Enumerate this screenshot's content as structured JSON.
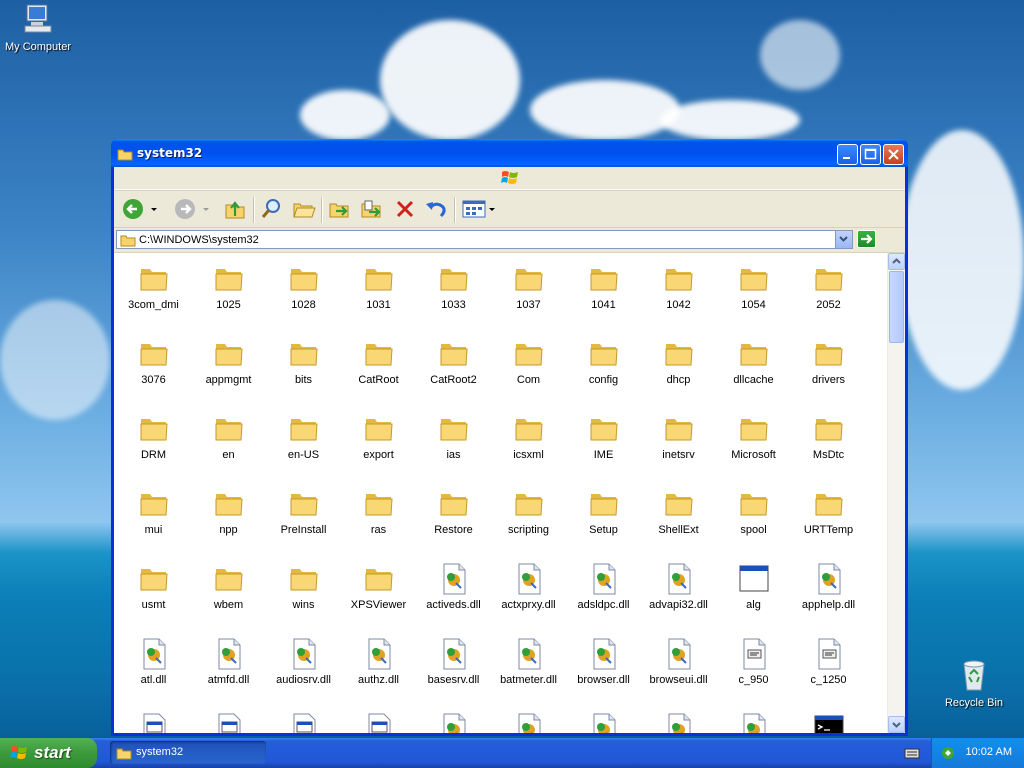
{
  "desktop": {
    "icons": [
      {
        "label": "My Computer"
      },
      {
        "label": "Recycle Bin"
      }
    ]
  },
  "window": {
    "title": "system32",
    "address": "C:\\WINDOWS\\system32"
  },
  "items": [
    {
      "label": "3com_dmi",
      "type": "folder"
    },
    {
      "label": "1025",
      "type": "folder"
    },
    {
      "label": "1028",
      "type": "folder"
    },
    {
      "label": "1031",
      "type": "folder"
    },
    {
      "label": "1033",
      "type": "folder"
    },
    {
      "label": "1037",
      "type": "folder"
    },
    {
      "label": "1041",
      "type": "folder"
    },
    {
      "label": "1042",
      "type": "folder"
    },
    {
      "label": "1054",
      "type": "folder"
    },
    {
      "label": "2052",
      "type": "folder"
    },
    {
      "label": "3076",
      "type": "folder"
    },
    {
      "label": "appmgmt",
      "type": "folder"
    },
    {
      "label": "bits",
      "type": "folder"
    },
    {
      "label": "CatRoot",
      "type": "folder"
    },
    {
      "label": "CatRoot2",
      "type": "folder"
    },
    {
      "label": "Com",
      "type": "folder"
    },
    {
      "label": "config",
      "type": "folder"
    },
    {
      "label": "dhcp",
      "type": "folder"
    },
    {
      "label": "dllcache",
      "type": "folder"
    },
    {
      "label": "drivers",
      "type": "folder"
    },
    {
      "label": "DRM",
      "type": "folder"
    },
    {
      "label": "en",
      "type": "folder"
    },
    {
      "label": "en-US",
      "type": "folder"
    },
    {
      "label": "export",
      "type": "folder"
    },
    {
      "label": "ias",
      "type": "folder"
    },
    {
      "label": "icsxml",
      "type": "folder"
    },
    {
      "label": "IME",
      "type": "folder"
    },
    {
      "label": "inetsrv",
      "type": "folder"
    },
    {
      "label": "Microsoft",
      "type": "folder"
    },
    {
      "label": "MsDtc",
      "type": "folder"
    },
    {
      "label": "mui",
      "type": "folder"
    },
    {
      "label": "npp",
      "type": "folder"
    },
    {
      "label": "PreInstall",
      "type": "folder"
    },
    {
      "label": "ras",
      "type": "folder"
    },
    {
      "label": "Restore",
      "type": "folder"
    },
    {
      "label": "scripting",
      "type": "folder"
    },
    {
      "label": "Setup",
      "type": "folder"
    },
    {
      "label": "ShellExt",
      "type": "folder"
    },
    {
      "label": "spool",
      "type": "folder"
    },
    {
      "label": "URTTemp",
      "type": "folder"
    },
    {
      "label": "usmt",
      "type": "folder"
    },
    {
      "label": "wbem",
      "type": "folder"
    },
    {
      "label": "wins",
      "type": "folder"
    },
    {
      "label": "XPSViewer",
      "type": "folder"
    },
    {
      "label": "activeds.dll",
      "type": "dll"
    },
    {
      "label": "actxprxy.dll",
      "type": "dll"
    },
    {
      "label": "adsldpc.dll",
      "type": "dll"
    },
    {
      "label": "advapi32.dll",
      "type": "dll"
    },
    {
      "label": "alg",
      "type": "exe"
    },
    {
      "label": "apphelp.dll",
      "type": "dll"
    },
    {
      "label": "atl.dll",
      "type": "dll"
    },
    {
      "label": "atmfd.dll",
      "type": "dll"
    },
    {
      "label": "audiosrv.dll",
      "type": "dll"
    },
    {
      "label": "authz.dll",
      "type": "dll"
    },
    {
      "label": "basesrv.dll",
      "type": "dll"
    },
    {
      "label": "batmeter.dll",
      "type": "dll"
    },
    {
      "label": "browser.dll",
      "type": "dll"
    },
    {
      "label": "browseui.dll",
      "type": "dll"
    },
    {
      "label": "c_950",
      "type": "nls"
    },
    {
      "label": "c_1250",
      "type": "nls"
    },
    {
      "label": "",
      "type": "win"
    },
    {
      "label": "",
      "type": "win"
    },
    {
      "label": "",
      "type": "win"
    },
    {
      "label": "",
      "type": "win"
    },
    {
      "label": "",
      "type": "dll"
    },
    {
      "label": "",
      "type": "dll"
    },
    {
      "label": "",
      "type": "dll"
    },
    {
      "label": "",
      "type": "dll"
    },
    {
      "label": "",
      "type": "dll"
    },
    {
      "label": "",
      "type": "cmd"
    }
  ],
  "taskbar": {
    "start_label": "start",
    "task_label": "system32",
    "clock": "10:02 AM"
  }
}
